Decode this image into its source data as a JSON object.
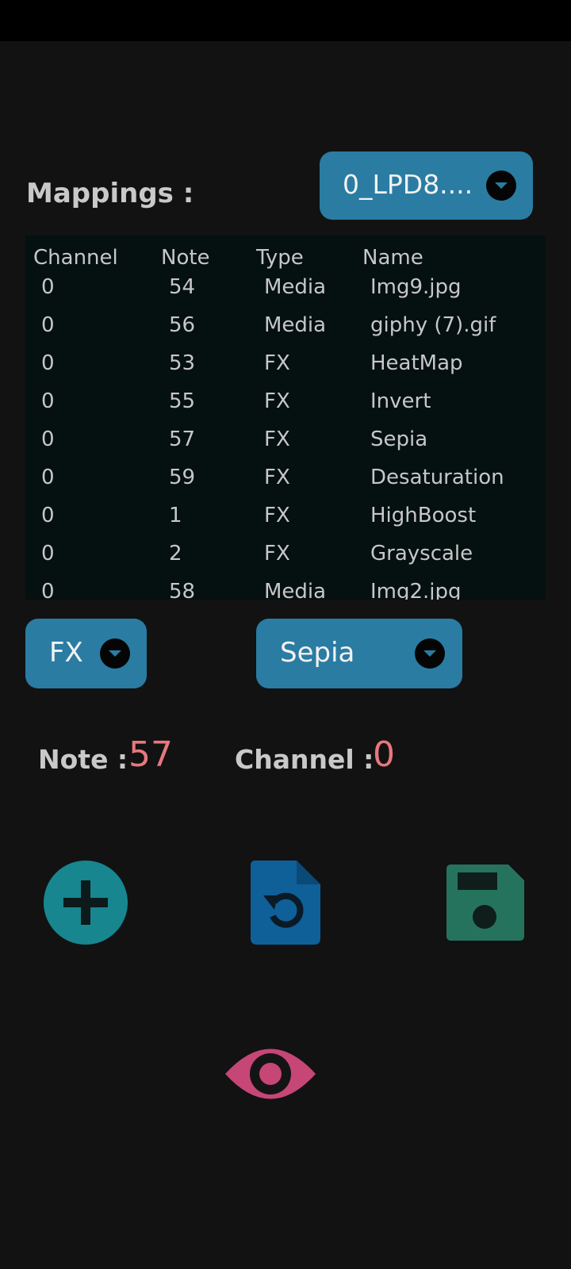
{
  "header": {
    "mappings_label": "Mappings :",
    "device_selected": "0_LPD8...."
  },
  "table": {
    "headers": [
      "Channel",
      "Note",
      "Type",
      "Name"
    ],
    "rows": [
      [
        "0",
        "54",
        "Media",
        "Img9.jpg"
      ],
      [
        "0",
        "56",
        "Media",
        "giphy (7).gif"
      ],
      [
        "0",
        "53",
        "FX",
        "HeatMap"
      ],
      [
        "0",
        "55",
        "FX",
        "Invert"
      ],
      [
        "0",
        "57",
        "FX",
        "Sepia"
      ],
      [
        "0",
        "59",
        "FX",
        "Desaturation"
      ],
      [
        "0",
        "1",
        "FX",
        "HighBoost"
      ],
      [
        "0",
        "2",
        "FX",
        "Grayscale"
      ],
      [
        "0",
        "58",
        "Media",
        "Img2.jpg"
      ]
    ]
  },
  "editor": {
    "type_selected": "FX",
    "name_selected": "Sepia",
    "note_label": "Note :",
    "note_value": "57",
    "channel_label": "Channel :",
    "channel_value": "0"
  },
  "actions": {
    "add_icon": "add-circle-icon",
    "reload_icon": "file-reload-icon",
    "save_icon": "floppy-save-icon",
    "preview_icon": "eye-icon"
  },
  "colors": {
    "background": "#121212",
    "table_background": "#051010",
    "select_background": "#2a7ca3",
    "value_accent": "#e8777f",
    "add_button": "#17868f",
    "reload_button": "#0f5f99",
    "save_button": "#26735d",
    "preview_button": "#c64676"
  }
}
